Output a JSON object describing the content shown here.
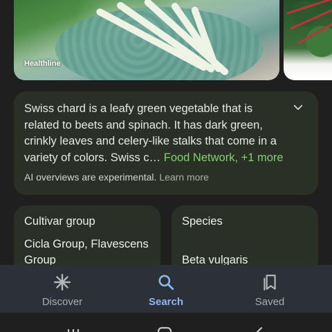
{
  "image_strip": {
    "source_label": "Healthline"
  },
  "ai_overview": {
    "text": "Swiss chard is a leafy green vegetable that is related to beets and spinach. It has dark green, crinkly leaves and celery-like stalks that come in a variety of colors. Swiss c",
    "ellipsis": "…",
    "sources_link": "Food Network, +1 more",
    "disclaimer": "AI overviews are experimental.",
    "learn_more": "Learn more",
    "expand_icon": "chevron-down-icon"
  },
  "info_cards": [
    {
      "title": "Cultivar group",
      "value": "Cicla Group, Flavescens Group"
    },
    {
      "title": "Species",
      "value": "Beta vulgaris"
    }
  ],
  "bottom_nav": {
    "items": [
      {
        "label": "Discover",
        "icon": "asterisk-icon",
        "active": false
      },
      {
        "label": "Search",
        "icon": "search-icon",
        "active": true
      },
      {
        "label": "Saved",
        "icon": "bookmarks-icon",
        "active": false
      }
    ]
  },
  "colors": {
    "background": "#1f1f1f",
    "card": "#2a3026",
    "link_green": "#7fd46b",
    "nav_active": "#8fb4f4",
    "nav_bar": "#2b3136"
  }
}
